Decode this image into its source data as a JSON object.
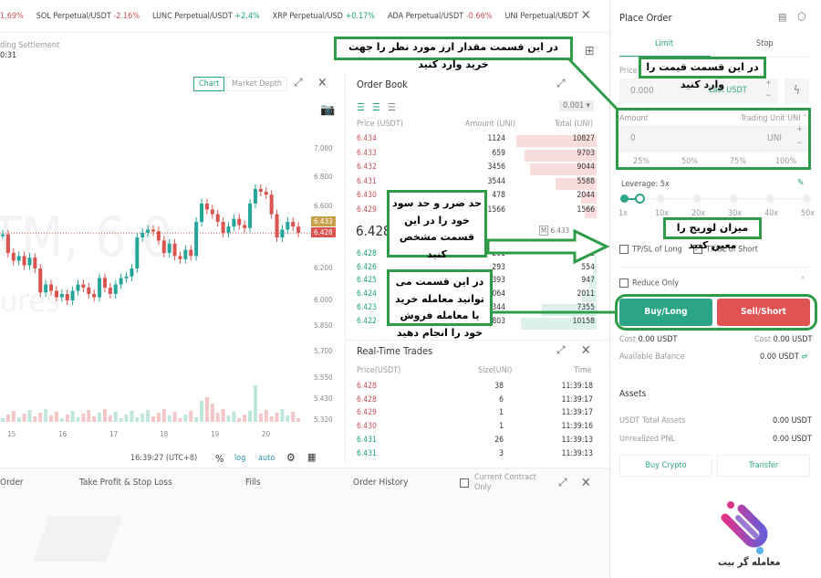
{
  "ticker": [
    {
      "name": "",
      "change": "1.69%",
      "dir": "neg"
    },
    {
      "name": "SOL Perpetual/USDT",
      "change": "-2.16%",
      "dir": "neg"
    },
    {
      "name": "LUNC Perpetual/USDT",
      "change": "+2.4%",
      "dir": "pos"
    },
    {
      "name": "XRP Perpetual/USD",
      "change": "+0.17%",
      "dir": "pos"
    },
    {
      "name": "ADA Perpetual/USDT",
      "change": "-0.66%",
      "dir": "neg"
    },
    {
      "name": "UNI Perpetual/USDT",
      "change": "",
      "dir": "neg"
    }
  ],
  "settlement": {
    "label": "ding Settlement",
    "value": "0:31"
  },
  "chart": {
    "tab_chart": "Chart",
    "tab_depth": "Market Depth",
    "watermark1": "TM, 6.0",
    "watermark2": "ures",
    "y_ticks": [
      "7.000",
      "6.800",
      "6.600",
      "6.200",
      "6.000",
      "5.850",
      "5.700",
      "5.550",
      "5.430",
      "5.320"
    ],
    "x_ticks": [
      "15",
      "16",
      "17",
      "18",
      "19",
      "20"
    ],
    "price_tag_ask": "6.433",
    "price_tag_last": "6.428",
    "time": "16:39:27 (UTC+8)",
    "pct": "%",
    "log": "log",
    "auto": "auto",
    "closes": [
      6.42,
      6.3,
      6.25,
      6.28,
      6.22,
      6.27,
      6.2,
      6.05,
      6.1,
      6.06,
      6.02,
      6.04,
      6.0,
      6.06,
      6.1,
      6.08,
      6.04,
      6.02,
      6.14,
      6.08,
      6.04,
      6.1,
      6.14,
      6.15,
      6.2,
      6.4,
      6.43,
      6.45,
      6.44,
      6.38,
      6.3,
      6.36,
      6.28,
      6.26,
      6.32,
      6.28,
      6.5,
      6.62,
      6.58,
      6.55,
      6.5,
      6.43,
      6.47,
      6.52,
      6.48,
      6.46,
      6.62,
      6.72,
      6.7,
      6.68,
      6.55,
      6.4,
      6.45,
      6.5,
      6.47,
      6.43
    ],
    "colors": {
      "up": "#26a69a",
      "down": "#d9534f"
    }
  },
  "bottom_tabs": [
    "Order",
    "Take Profit & Stop Loss",
    "Fills",
    "Order History"
  ],
  "current_contract": "Current Contract Only",
  "orderbook": {
    "title": "Order Book",
    "precision": "0.001",
    "headers": [
      "Price (USDT)",
      "Amount (UNI)",
      "Total (UNI)"
    ],
    "asks": [
      [
        "6.434",
        "1124",
        "10827"
      ],
      [
        "6.433",
        "659",
        "9703"
      ],
      [
        "6.432",
        "3456",
        "9044"
      ],
      [
        "6.431",
        "3544",
        "5588"
      ],
      [
        "6.430",
        "478",
        "2044"
      ],
      [
        "6.429",
        "1566",
        "1566"
      ]
    ],
    "mid": "6.428",
    "mark": "6.433",
    "bids": [
      [
        "6.428",
        "261",
        "261"
      ],
      [
        "6.426",
        "293",
        "554"
      ],
      [
        "6.425",
        "393",
        "947"
      ],
      [
        "6.424",
        "1064",
        "2011"
      ],
      [
        "6.423",
        "5344",
        "7355"
      ],
      [
        "6.422",
        "2803",
        "10158"
      ]
    ]
  },
  "trades": {
    "title": "Real-Time Trades",
    "headers": [
      "Price(USDT)",
      "Size(UNI)",
      "Time"
    ],
    "rows": [
      [
        "6.428",
        "38",
        "11:39:18",
        "neg"
      ],
      [
        "6.428",
        "6",
        "11:39:17",
        "neg"
      ],
      [
        "6.429",
        "1",
        "11:39:17",
        "neg"
      ],
      [
        "6.430",
        "1",
        "11:39:16",
        "neg"
      ],
      [
        "6.431",
        "26",
        "11:39:13",
        "pos"
      ],
      [
        "6.431",
        "3",
        "11:39:13",
        "pos"
      ]
    ]
  },
  "order": {
    "title": "Place Order",
    "tab_limit": "Limit",
    "tab_stop": "Stop",
    "price_label": "Price",
    "price_placeholder": "0.000",
    "price_unit": "Last USDT",
    "amount_label": "Amount",
    "trading_unit": "Trading Unit UNI",
    "amount_placeholder": "0",
    "amount_unit": "UNI",
    "pcts": [
      "25%",
      "50%",
      "75%",
      "100%"
    ],
    "leverage_label": "Leverage: 5x",
    "leverage_marks": [
      "1x",
      "10x",
      "20x",
      "30x",
      "40x",
      "50x"
    ],
    "tpsl_long": "TP/SL of Long",
    "tpsl_short": "TP/SL of Short",
    "reduce_only": "Reduce Only",
    "buy": "Buy/Long",
    "sell": "Sell/Short",
    "cost_label": "Cost",
    "cost_buy": "0.00 USDT",
    "cost_sell": "0.00 USDT",
    "avail_label": "Available Balance",
    "avail_value": "0.00 USDT",
    "assets_title": "Assets",
    "total_label": "USDT Total Assets",
    "total_value": "0.00 USDT",
    "pnl_label": "Unrealized PNL",
    "pnl_value": "0.00 USDT",
    "buy_crypto": "Buy Crypto",
    "transfer": "Transfer",
    "buy_color": "#2aa585",
    "sell_color": "#e05353"
  },
  "annotations": {
    "amount": "در این قسمت مقدار ارز مورد نظر را جهت خرید وارد کنید",
    "price": "در این قسمت قیمت را وارد کنید",
    "leverage": "میزان لوریج را معین کنید",
    "tpsl": "حد ضرر و حد سود خود را در این قسمت مشخص کنید",
    "trade": "در این قسمت می توانید معامله خرید یا معامله فروش خود را انجام دهید"
  },
  "logo": {
    "text": "معامله گر بیت"
  }
}
